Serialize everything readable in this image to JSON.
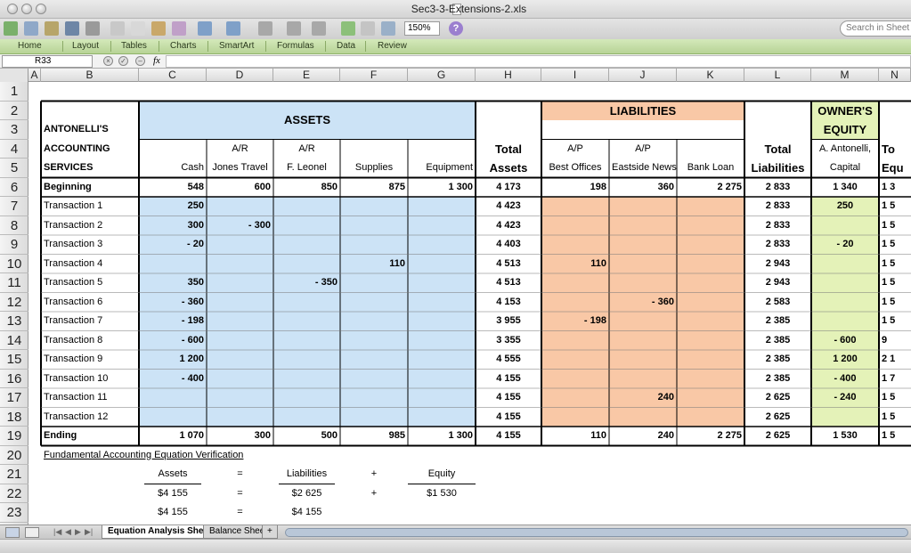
{
  "window": {
    "title": "Sec3-3-Extensions-2.xls"
  },
  "toolbar": {
    "zoom": "150%",
    "search_placeholder": "Search in Sheet"
  },
  "ribbon": {
    "tabs": [
      "Home",
      "Layout",
      "Tables",
      "Charts",
      "SmartArt",
      "Formulas",
      "Data",
      "Review"
    ]
  },
  "formula_bar": {
    "name_box": "R33",
    "fx": "fx",
    "value": ""
  },
  "columns": [
    "A",
    "B",
    "C",
    "D",
    "E",
    "F",
    "G",
    "H",
    "I",
    "J",
    "K",
    "L",
    "M",
    "N"
  ],
  "rows": [
    "1",
    "2",
    "3",
    "4",
    "5",
    "6",
    "7",
    "8",
    "9",
    "10",
    "11",
    "12",
    "13",
    "14",
    "15",
    "16",
    "17",
    "18",
    "19",
    "20",
    "21",
    "22",
    "23"
  ],
  "header": {
    "assets": "ASSETS",
    "liabilities": "LIABILITIES",
    "owners1": "OWNER'S",
    "owners2": "EQUITY",
    "company1": "ANTONELLI'S",
    "company2": "ACCOUNTING",
    "company3": "SERVICES",
    "ar": "A/R",
    "ap": "A/P",
    "cash": "Cash",
    "jones": "Jones Travel",
    "leonel": "F. Leonel",
    "supplies": "Supplies",
    "equipment": "Equipment",
    "total": "Total",
    "assets_lbl": "Assets",
    "best": "Best Offices",
    "eastside": "Eastside News",
    "bank": "Bank Loan",
    "liab_lbl": "Liabilities",
    "antonelli": "A. Antonelli,",
    "capital": "Capital",
    "to": "To",
    "equ": "Equ"
  },
  "table": [
    {
      "label": "Beginning",
      "c": "548",
      "d": "600",
      "e": "850",
      "f": "875",
      "g": "1 300",
      "h": "4 173",
      "i": "198",
      "j": "360",
      "k": "2 275",
      "l": "2 833",
      "m": "1 340",
      "n": "1 3"
    },
    {
      "label": "Transaction 1",
      "c": "250",
      "d": "",
      "e": "",
      "f": "",
      "g": "",
      "h": "4 423",
      "i": "",
      "j": "",
      "k": "",
      "l": "2 833",
      "m": "250",
      "n": "1 5"
    },
    {
      "label": "Transaction 2",
      "c": "300",
      "d": "- 300",
      "e": "",
      "f": "",
      "g": "",
      "h": "4 423",
      "i": "",
      "j": "",
      "k": "",
      "l": "2 833",
      "m": "",
      "n": "1 5"
    },
    {
      "label": "Transaction 3",
      "c": "- 20",
      "d": "",
      "e": "",
      "f": "",
      "g": "",
      "h": "4 403",
      "i": "",
      "j": "",
      "k": "",
      "l": "2 833",
      "m": "- 20",
      "n": "1 5"
    },
    {
      "label": "Transaction 4",
      "c": "",
      "d": "",
      "e": "",
      "f": "110",
      "g": "",
      "h": "4 513",
      "i": "110",
      "j": "",
      "k": "",
      "l": "2 943",
      "m": "",
      "n": "1 5"
    },
    {
      "label": "Transaction 5",
      "c": "350",
      "d": "",
      "e": "- 350",
      "f": "",
      "g": "",
      "h": "4 513",
      "i": "",
      "j": "",
      "k": "",
      "l": "2 943",
      "m": "",
      "n": "1 5"
    },
    {
      "label": "Transaction 6",
      "c": "- 360",
      "d": "",
      "e": "",
      "f": "",
      "g": "",
      "h": "4 153",
      "i": "",
      "j": "- 360",
      "k": "",
      "l": "2 583",
      "m": "",
      "n": "1 5"
    },
    {
      "label": "Transaction 7",
      "c": "- 198",
      "d": "",
      "e": "",
      "f": "",
      "g": "",
      "h": "3 955",
      "i": "- 198",
      "j": "",
      "k": "",
      "l": "2 385",
      "m": "",
      "n": "1 5"
    },
    {
      "label": "Transaction 8",
      "c": "- 600",
      "d": "",
      "e": "",
      "f": "",
      "g": "",
      "h": "3 355",
      "i": "",
      "j": "",
      "k": "",
      "l": "2 385",
      "m": "- 600",
      "n": "9"
    },
    {
      "label": "Transaction 9",
      "c": "1 200",
      "d": "",
      "e": "",
      "f": "",
      "g": "",
      "h": "4 555",
      "i": "",
      "j": "",
      "k": "",
      "l": "2 385",
      "m": "1 200",
      "n": "2 1"
    },
    {
      "label": "Transaction 10",
      "c": "- 400",
      "d": "",
      "e": "",
      "f": "",
      "g": "",
      "h": "4 155",
      "i": "",
      "j": "",
      "k": "",
      "l": "2 385",
      "m": "- 400",
      "n": "1 7"
    },
    {
      "label": "Transaction 11",
      "c": "",
      "d": "",
      "e": "",
      "f": "",
      "g": "",
      "h": "4 155",
      "i": "",
      "j": "240",
      "k": "",
      "l": "2 625",
      "m": "- 240",
      "n": "1 5"
    },
    {
      "label": "Transaction 12",
      "c": "",
      "d": "",
      "e": "",
      "f": "",
      "g": "",
      "h": "4 155",
      "i": "",
      "j": "",
      "k": "",
      "l": "2 625",
      "m": "",
      "n": "1 5"
    },
    {
      "label": "Ending",
      "c": "1 070",
      "d": "300",
      "e": "500",
      "f": "985",
      "g": "1 300",
      "h": "4 155",
      "i": "110",
      "j": "240",
      "k": "2 275",
      "l": "2 625",
      "m": "1 530",
      "n": "1 5"
    }
  ],
  "verification": {
    "title": "Fundamental Accounting Equation Verification",
    "assets": "Assets",
    "eq": "=",
    "liabilities": "Liabilities",
    "plus": "+",
    "equity": "Equity",
    "r22_assets": "$4 155",
    "r22_liab": "$2 625",
    "r22_equity": "$1 530",
    "r23_assets": "$4 155",
    "r23_liab": "$4 155"
  },
  "sheets": [
    "Equation Analysis Sheet",
    "Balance Sheet",
    "+"
  ],
  "colors": {
    "assets": "#cce3f6",
    "liabilities": "#f9c8a6",
    "equity": "#e4f2b8",
    "ribbon": "#c6dfa8"
  }
}
